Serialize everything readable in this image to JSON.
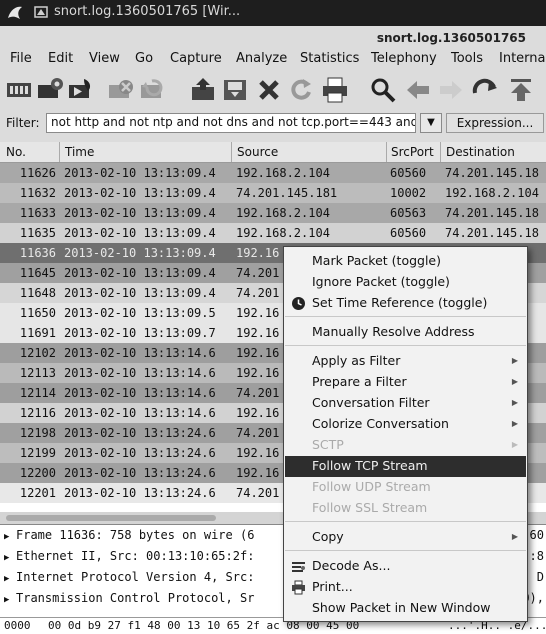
{
  "window": {
    "title": "snort.log.1360501765  [Wir...",
    "filename_label": "snort.log.1360501765"
  },
  "menubar": [
    "File",
    "Edit",
    "View",
    "Go",
    "Capture",
    "Analyze",
    "Statistics",
    "Telephony",
    "Tools",
    "Interna"
  ],
  "toolbar": {
    "icons": [
      "interface-list-icon",
      "capture-options-icon",
      "start-capture-icon",
      "stop-capture-icon",
      "restart-capture-icon",
      "open-file-icon",
      "save-file-icon",
      "close-file-icon",
      "reload-icon",
      "print-icon",
      "find-packet-icon",
      "go-back-icon",
      "go-forward-icon",
      "go-to-packet-icon",
      "go-first-icon"
    ]
  },
  "filter": {
    "label": "Filter:",
    "value": "not http and not ntp and not dns and not tcp.port==443 and",
    "expression_label": "Expression..."
  },
  "packet_list": {
    "columns": [
      "No.",
      "Time",
      "Source",
      "SrcPort",
      "Destination"
    ],
    "rows": [
      {
        "no": "11626",
        "time": "2013-02-10 13:13:09.4",
        "source": "192.168.2.104",
        "srcport": "60560",
        "dest": "74.201.145.18",
        "shade": "#a8a8a8"
      },
      {
        "no": "11632",
        "time": "2013-02-10 13:13:09.4",
        "source": "74.201.145.181",
        "srcport": "10002",
        "dest": "192.168.2.104",
        "shade": "#bcbcbc"
      },
      {
        "no": "11633",
        "time": "2013-02-10 13:13:09.4",
        "source": "192.168.2.104",
        "srcport": "60563",
        "dest": "74.201.145.18",
        "shade": "#a8a8a8"
      },
      {
        "no": "11635",
        "time": "2013-02-10 13:13:09.4",
        "source": "192.168.2.104",
        "srcport": "60560",
        "dest": "74.201.145.18",
        "shade": "#d2d2d2"
      },
      {
        "no": "11636",
        "time": "2013-02-10 13:13:09.4",
        "source": "192.16",
        "srcport": "",
        "dest": ".18",
        "shade": "#6f6f6f",
        "selected": true
      },
      {
        "no": "11645",
        "time": "2013-02-10 13:13:09.4",
        "source": "74.201",
        "srcport": "",
        "dest": ".18",
        "shade": "#a0a0a0"
      },
      {
        "no": "11648",
        "time": "2013-02-10 13:13:09.4",
        "source": "74.201",
        "srcport": "",
        "dest": ".18",
        "shade": "#d6d6d6"
      },
      {
        "no": "11650",
        "time": "2013-02-10 13:13:09.5",
        "source": "192.16",
        "srcport": "",
        "dest": ".18",
        "shade": "#e6e6e6"
      },
      {
        "no": "11691",
        "time": "2013-02-10 13:13:09.7",
        "source": "192.16",
        "srcport": "",
        "dest": ".18",
        "shade": "#e6e6e6"
      },
      {
        "no": "12102",
        "time": "2013-02-10 13:13:14.6",
        "source": "192.16",
        "srcport": "",
        "dest": ".18",
        "shade": "#9e9e9e"
      },
      {
        "no": "12113",
        "time": "2013-02-10 13:13:14.6",
        "source": "192.16",
        "srcport": "",
        "dest": ".18",
        "shade": "#bababa"
      },
      {
        "no": "12114",
        "time": "2013-02-10 13:13:14.6",
        "source": "74.201",
        "srcport": "",
        "dest": ".18",
        "shade": "#9e9e9e"
      },
      {
        "no": "12116",
        "time": "2013-02-10 13:13:14.6",
        "source": "192.16",
        "srcport": "",
        "dest": ".18",
        "shade": "#d2d2d2"
      },
      {
        "no": "12198",
        "time": "2013-02-10 13:13:24.6",
        "source": "74.201",
        "srcport": "",
        "dest": ".18",
        "shade": "#a0a0a0"
      },
      {
        "no": "12199",
        "time": "2013-02-10 13:13:24.6",
        "source": "192.16",
        "srcport": "",
        "dest": ".18",
        "shade": "#bdbdbd"
      },
      {
        "no": "12200",
        "time": "2013-02-10 13:13:24.6",
        "source": "192.16",
        "srcport": "",
        "dest": ".18",
        "shade": "#a0a0a0"
      },
      {
        "no": "12201",
        "time": "2013-02-10 13:13:24.6",
        "source": "74.201",
        "srcport": "",
        "dest": ".18",
        "shade": "#e8e8e8"
      }
    ]
  },
  "details": [
    {
      "left": "Frame 11636: 758 bytes on wire (6",
      "right": "(60"
    },
    {
      "left": "Ethernet II, Src: 00:13:10:65:2f:",
      "right": ":8"
    },
    {
      "left": "Internet Protocol Version 4, Src:",
      "right": ", D"
    },
    {
      "left": "Transmission Control Protocol, Sr",
      "right": "0),"
    }
  ],
  "hex": {
    "offset": "0000",
    "bytes": "00 0d b9 27 f1 48 00 13   10 65 2f ac 08 00 45 00",
    "ascii": "...'.H.. .e/...E."
  },
  "context_menu": {
    "items": [
      {
        "label": "Mark Packet (toggle)"
      },
      {
        "label": "Ignore Packet (toggle)"
      },
      {
        "label": "Set Time Reference (toggle)",
        "icon": "clock-icon"
      },
      {
        "label": "Manually Resolve Address"
      },
      {
        "label": "Apply as Filter",
        "submenu": true
      },
      {
        "label": "Prepare a Filter",
        "submenu": true
      },
      {
        "label": "Conversation Filter",
        "submenu": true
      },
      {
        "label": "Colorize Conversation",
        "submenu": true
      },
      {
        "label": "SCTP",
        "submenu": true,
        "disabled": true
      },
      {
        "label": "Follow TCP Stream",
        "highlighted": true
      },
      {
        "label": "Follow UDP Stream",
        "disabled": true
      },
      {
        "label": "Follow SSL Stream",
        "disabled": true
      },
      {
        "label": "Copy",
        "submenu": true
      },
      {
        "label": "Decode As...",
        "icon": "decode-icon"
      },
      {
        "label": "Print...",
        "icon": "printer-icon"
      },
      {
        "label": "Show Packet in New Window"
      }
    ],
    "submenu_glyph": "▶"
  },
  "colors": {
    "selected_row": "#6f6f6f",
    "menu_highlight": "#2d2d2d",
    "titlebar": "#1e1e1e"
  }
}
